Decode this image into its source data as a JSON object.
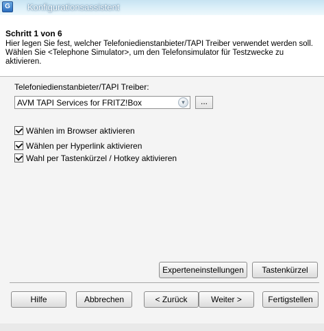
{
  "window": {
    "title": "Konfigurationsassistent"
  },
  "header": {
    "step_title": "Schritt 1 von 6",
    "description": "Hier legen Sie fest, welcher Telefoniedienstanbieter/TAPI Treiber verwendet werden soll. Wählen Sie <Telephone Simulator>, um den Telefonsimulator für Testzwecke zu aktivieren."
  },
  "provider": {
    "label": "Telefoniedienstanbieter/TAPI Treiber:",
    "selected": "AVM TAPI Services for FRITZ!Box",
    "browse_label": "..."
  },
  "options": [
    {
      "label": "Wählen im Browser aktivieren",
      "checked": true
    },
    {
      "label": "Wählen per Hyperlink aktivieren",
      "checked": true
    },
    {
      "label": "Wahl per Tastenkürzel / Hotkey aktivieren",
      "checked": true
    }
  ],
  "advanced": {
    "expert_label": "Experteneinstellungen",
    "hotkey_label": "Tastenkürzel"
  },
  "nav": {
    "help_label": "Hilfe",
    "cancel_label": "Abbrechen",
    "back_label": "< Zurück",
    "next_label": "Weiter >",
    "finish_label": "Fertigstellen"
  }
}
